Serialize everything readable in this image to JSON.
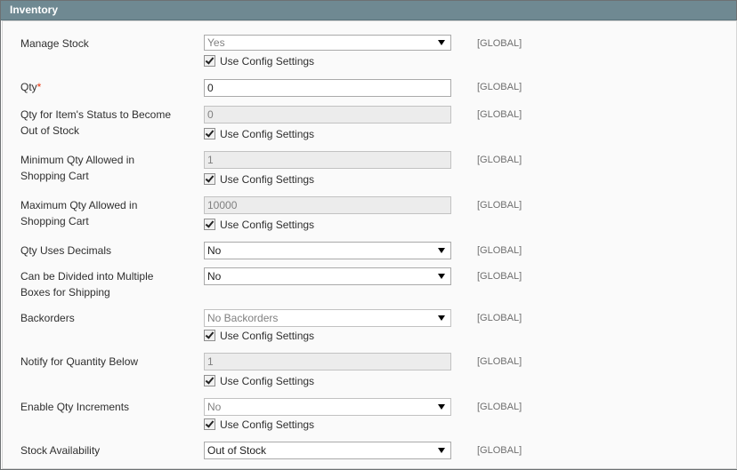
{
  "section": {
    "title": "Inventory"
  },
  "fields": [
    {
      "label": "Manage Stock",
      "value": "Yes",
      "scope": "[GLOBAL]",
      "config": "Use Config Settings"
    },
    {
      "label": "Qty",
      "required_mark": "*",
      "value": "0",
      "scope": "[GLOBAL]"
    },
    {
      "label_line1": "Qty for Item's Status to Become",
      "label_line2": "Out of Stock",
      "value": "0",
      "scope": "[GLOBAL]",
      "config": "Use Config Settings"
    },
    {
      "label_line1": "Minimum Qty Allowed in",
      "label_line2": "Shopping Cart",
      "value": "1",
      "scope": "[GLOBAL]",
      "config": "Use Config Settings"
    },
    {
      "label_line1": "Maximum Qty Allowed in",
      "label_line2": "Shopping Cart",
      "value": "10000",
      "scope": "[GLOBAL]",
      "config": "Use Config Settings"
    },
    {
      "label": "Qty Uses Decimals",
      "value": "No",
      "scope": "[GLOBAL]"
    },
    {
      "label_line1": "Can be Divided into Multiple",
      "label_line2": "Boxes for Shipping",
      "value": "No",
      "scope": "[GLOBAL]"
    },
    {
      "label": "Backorders",
      "value": "No Backorders",
      "scope": "[GLOBAL]",
      "config": "Use Config Settings"
    },
    {
      "label": "Notify for Quantity Below",
      "value": "1",
      "scope": "[GLOBAL]",
      "config": "Use Config Settings"
    },
    {
      "label": "Enable Qty Increments",
      "value": "No",
      "scope": "[GLOBAL]",
      "config": "Use Config Settings"
    },
    {
      "label": "Stock Availability",
      "value": "Out of Stock",
      "scope": "[GLOBAL]"
    }
  ]
}
